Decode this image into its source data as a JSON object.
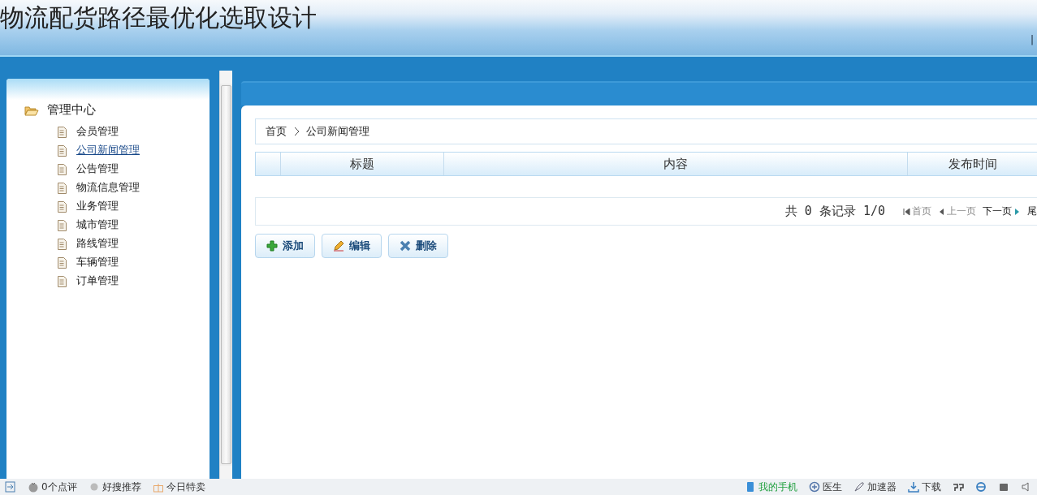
{
  "header": {
    "title": "物流配货路径最优化选取设计",
    "separator": "|"
  },
  "sidebar": {
    "root": {
      "label": "管理中心",
      "expanded": true,
      "children": [
        {
          "label": "会员管理",
          "hovered": false
        },
        {
          "label": "公司新闻管理",
          "hovered": true
        },
        {
          "label": "公告管理",
          "hovered": false
        },
        {
          "label": "物流信息管理",
          "hovered": false
        },
        {
          "label": "业务管理",
          "hovered": false
        },
        {
          "label": "城市管理",
          "hovered": false
        },
        {
          "label": "路线管理",
          "hovered": false
        },
        {
          "label": "车辆管理",
          "hovered": false
        },
        {
          "label": "订单管理",
          "hovered": false
        }
      ]
    }
  },
  "breadcrumb": [
    "首页",
    "公司新闻管理"
  ],
  "table": {
    "columns": [
      "标题",
      "内容",
      "发布时间"
    ]
  },
  "pager": {
    "summary": "共 0 条记录 1/0",
    "links": [
      {
        "kind": "first",
        "label": "首页",
        "disabled": true
      },
      {
        "kind": "prev",
        "label": "上一页",
        "disabled": true
      },
      {
        "kind": "next",
        "label": "下一页",
        "disabled": false
      },
      {
        "kind": "last",
        "label": "尾",
        "disabled": false
      }
    ]
  },
  "actions": [
    {
      "kind": "add",
      "label": "添加"
    },
    {
      "kind": "edit",
      "label": "编辑"
    },
    {
      "kind": "delete",
      "label": "删除"
    }
  ],
  "status_bar": {
    "left": [
      {
        "kind": "exit"
      },
      {
        "kind": "tomato",
        "label": "0个点评"
      },
      {
        "kind": "dot",
        "label": "好搜推荐"
      },
      {
        "kind": "gift",
        "label": "今日特卖"
      }
    ],
    "right": [
      {
        "kind": "phone",
        "label": "我的手机"
      },
      {
        "kind": "doctor",
        "label": "医生"
      },
      {
        "kind": "rocket",
        "label": "加速器"
      },
      {
        "kind": "download",
        "label": "下载"
      },
      {
        "kind": "pp"
      },
      {
        "kind": "ie"
      },
      {
        "kind": "window"
      },
      {
        "kind": "speaker"
      }
    ]
  }
}
